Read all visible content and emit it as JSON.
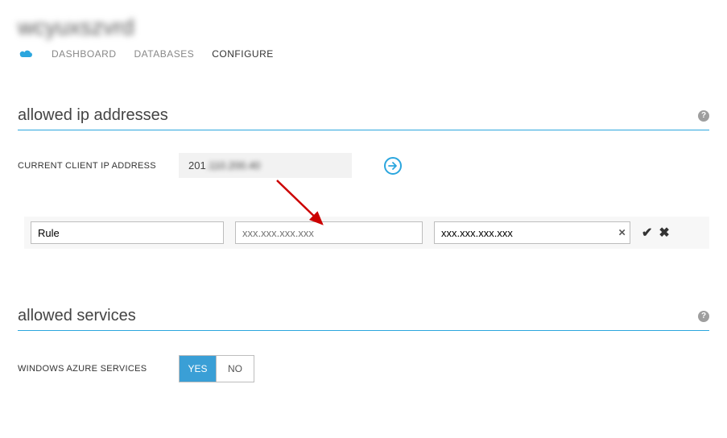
{
  "pageTitle": "wcyuxszvrd",
  "tabs": {
    "dashboard": "DASHBOARD",
    "databases": "DATABASES",
    "configure": "CONFIGURE"
  },
  "sections": {
    "allowedIp": {
      "heading": "allowed ip addresses",
      "clientIpLabel": "CURRENT CLIENT IP ADDRESS",
      "clientIpPrefix": "201",
      "clientIpBlur": ".110.200.40",
      "rule": {
        "nameValue": "Rule",
        "startPlaceholder": "xxx.xxx.xxx.xxx",
        "endValue": "xxx.xxx.xxx.xxx"
      }
    },
    "allowedServices": {
      "heading": "allowed services",
      "azureLabel": "WINDOWS AZURE SERVICES",
      "yes": "YES",
      "no": "NO"
    }
  }
}
